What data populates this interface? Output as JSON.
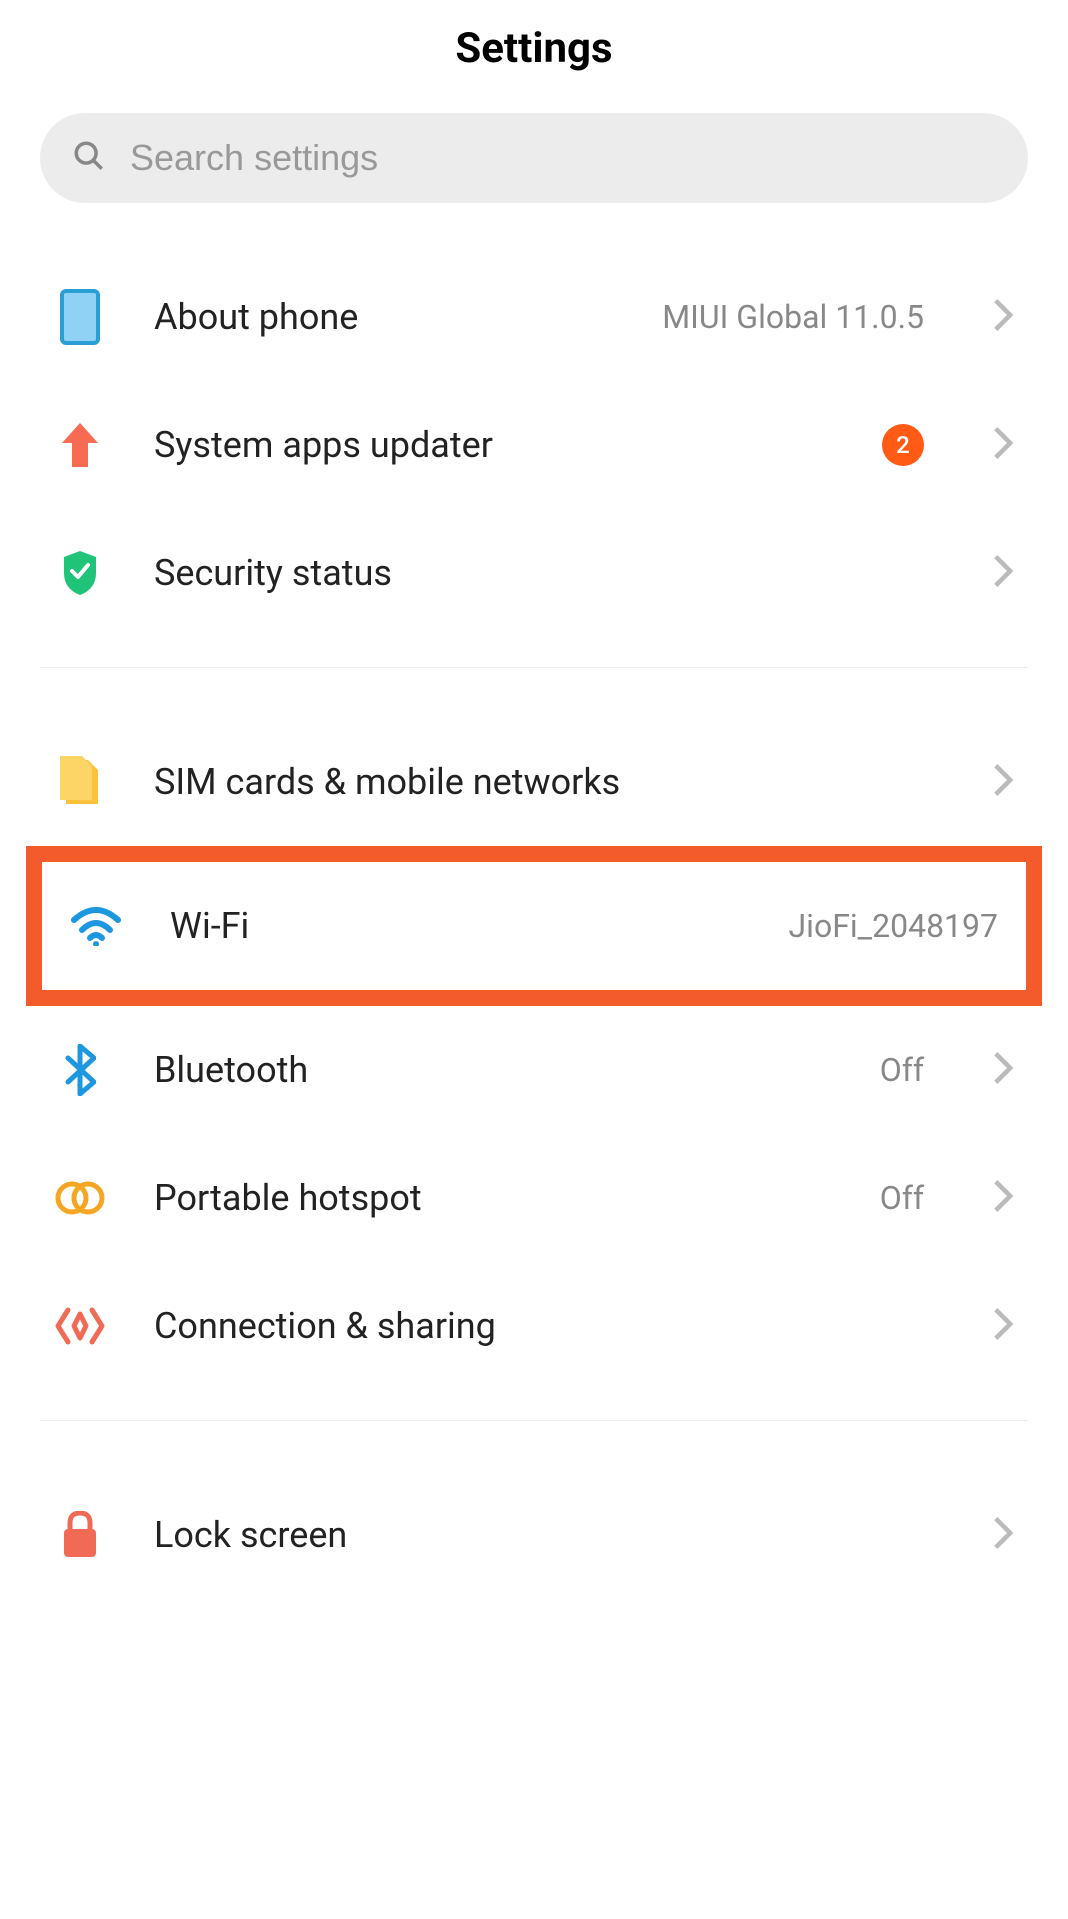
{
  "header": {
    "title": "Settings"
  },
  "search": {
    "placeholder": "Search settings"
  },
  "sections": [
    {
      "items": [
        {
          "id": "about-phone",
          "label": "About phone",
          "value": "MIUI Global 11.0.5",
          "icon": "phone-icon"
        },
        {
          "id": "system-apps-updater",
          "label": "System apps updater",
          "badge": "2",
          "icon": "arrow-up-icon"
        },
        {
          "id": "security-status",
          "label": "Security status",
          "icon": "shield-check-icon"
        }
      ]
    },
    {
      "items": [
        {
          "id": "sim-cards",
          "label": "SIM cards & mobile networks",
          "icon": "sim-icon"
        },
        {
          "id": "wifi",
          "label": "Wi-Fi",
          "value": "JioFi_2048197",
          "icon": "wifi-icon",
          "highlighted": true
        },
        {
          "id": "bluetooth",
          "label": "Bluetooth",
          "value": "Off",
          "icon": "bluetooth-icon"
        },
        {
          "id": "portable-hotspot",
          "label": "Portable hotspot",
          "value": "Off",
          "icon": "hotspot-icon"
        },
        {
          "id": "connection-sharing",
          "label": "Connection & sharing",
          "icon": "sharing-icon"
        }
      ]
    },
    {
      "items": [
        {
          "id": "lock-screen",
          "label": "Lock screen",
          "icon": "lock-icon"
        }
      ]
    }
  ]
}
